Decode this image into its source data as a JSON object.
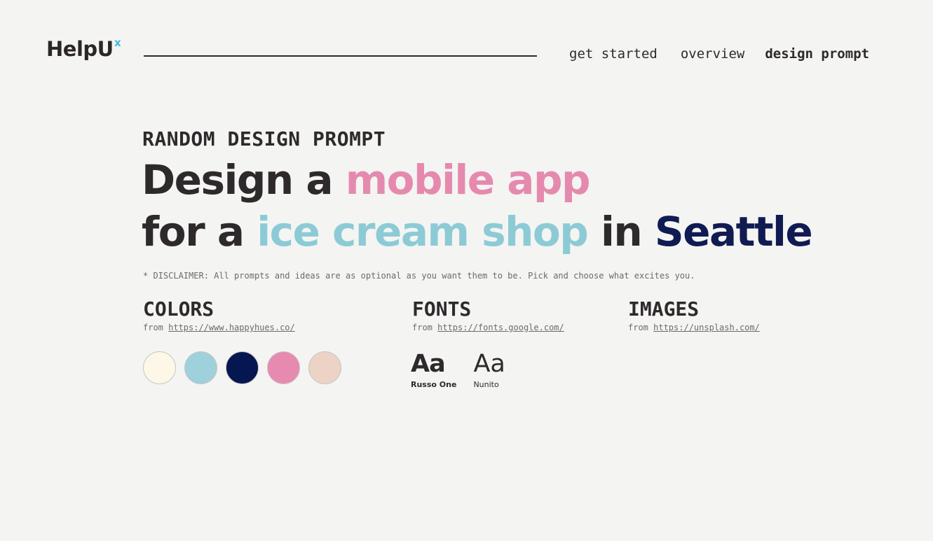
{
  "header": {
    "logo_text": "HelpU",
    "logo_superscript": "x",
    "nav": [
      {
        "label": "get started"
      },
      {
        "label": "overview"
      },
      {
        "label": "design prompt"
      }
    ]
  },
  "prompt": {
    "eyebrow": "RANDOM DESIGN PROMPT",
    "line1_prefix": "Design a ",
    "line1_highlight": "mobile app",
    "line2_prefix": "for a ",
    "line2_highlight": "ice cream shop",
    "line2_mid": " in ",
    "line2_location": "Seattle",
    "disclaimer": "* DISCLAIMER: All prompts and ideas are as optional as you want them to be. Pick and choose what excites you."
  },
  "colors": {
    "title": "COLORS",
    "from_label": "from ",
    "source": "https://www.happyhues.co/",
    "swatches": [
      "#fdf7e8",
      "#9ed1db",
      "#051650",
      "#e68aaf",
      "#ecd3c6"
    ],
    "accent": {
      "pink": "#e58aae",
      "blue": "#8ccbd6",
      "navy": "#0f1b52",
      "logo_x": "#3ebde5"
    }
  },
  "fonts": {
    "title": "FONTS",
    "from_label": "from ",
    "source": "https://fonts.google.com/",
    "samples": [
      {
        "glyph": "Aa",
        "name": "Russo One"
      },
      {
        "glyph": "Aa",
        "name": "Nunito"
      }
    ]
  },
  "images": {
    "title": "IMAGES",
    "from_label": "from ",
    "source": "https://unsplash.com/"
  }
}
